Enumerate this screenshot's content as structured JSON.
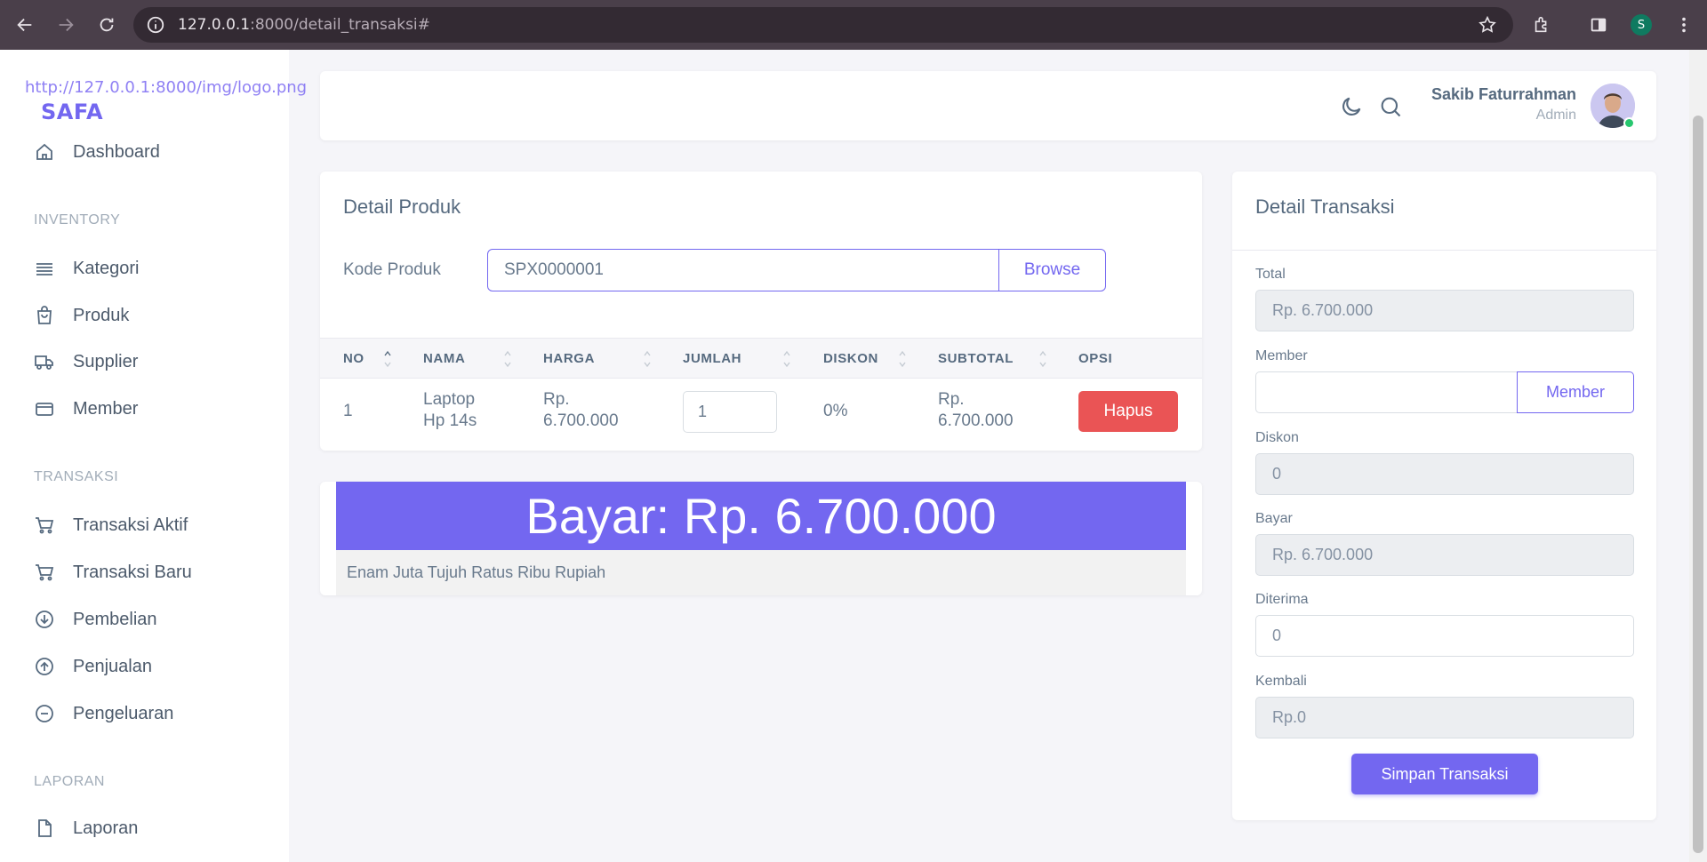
{
  "browser": {
    "url_host": "127.0.0.1",
    "url_rest": ":8000/detail_transaksi#",
    "profile_initial": "S"
  },
  "sidebar": {
    "logo_url_text": "http://127.0.0.1:8000/img/logo.png",
    "brand": "SAFA",
    "dashboard": "Dashboard",
    "section_inventory": "INVENTORY",
    "kategori": "Kategori",
    "produk": "Produk",
    "supplier": "Supplier",
    "member": "Member",
    "section_transaksi": "TRANSAKSI",
    "transaksi_aktif": "Transaksi Aktif",
    "transaksi_baru": "Transaksi Baru",
    "pembelian": "Pembelian",
    "penjualan": "Penjualan",
    "pengeluaran": "Pengeluaran",
    "section_laporan": "LAPORAN",
    "laporan": "Laporan"
  },
  "navbar": {
    "user_name": "Sakib Faturrahman",
    "user_role": "Admin"
  },
  "detail_produk": {
    "title": "Detail Produk",
    "kode_label": "Kode Produk",
    "kode_value": "SPX0000001",
    "browse_label": "Browse",
    "columns": [
      "NO",
      "NAMA",
      "HARGA",
      "JUMLAH",
      "DISKON",
      "SUBTOTAL",
      "OPSI"
    ],
    "rows": [
      {
        "no": "1",
        "nama_line1": "Laptop",
        "nama_line2": "Hp 14s",
        "harga_line1": "Rp.",
        "harga_line2": "6.700.000",
        "jumlah": "1",
        "diskon": "0%",
        "subtotal_line1": "Rp.",
        "subtotal_line2": "6.700.000",
        "hapus_label": "Hapus"
      }
    ]
  },
  "bayar": {
    "banner": "Bayar: Rp. 6.700.000",
    "terbilang": "Enam Juta Tujuh Ratus Ribu Rupiah"
  },
  "detail_transaksi": {
    "title": "Detail Transaksi",
    "total_label": "Total",
    "total_value": "Rp. 6.700.000",
    "member_label": "Member",
    "member_value": "",
    "member_button": "Member",
    "diskon_label": "Diskon",
    "diskon_value": "0",
    "bayar_label": "Bayar",
    "bayar_value": "Rp. 6.700.000",
    "diterima_label": "Diterima",
    "diterima_value": "0",
    "kembali_label": "Kembali",
    "kembali_value": "Rp.0",
    "simpan_label": "Simpan Transaksi"
  },
  "colors": {
    "primary": "#7367f0",
    "danger": "#ea5455",
    "online": "#28c76f"
  }
}
